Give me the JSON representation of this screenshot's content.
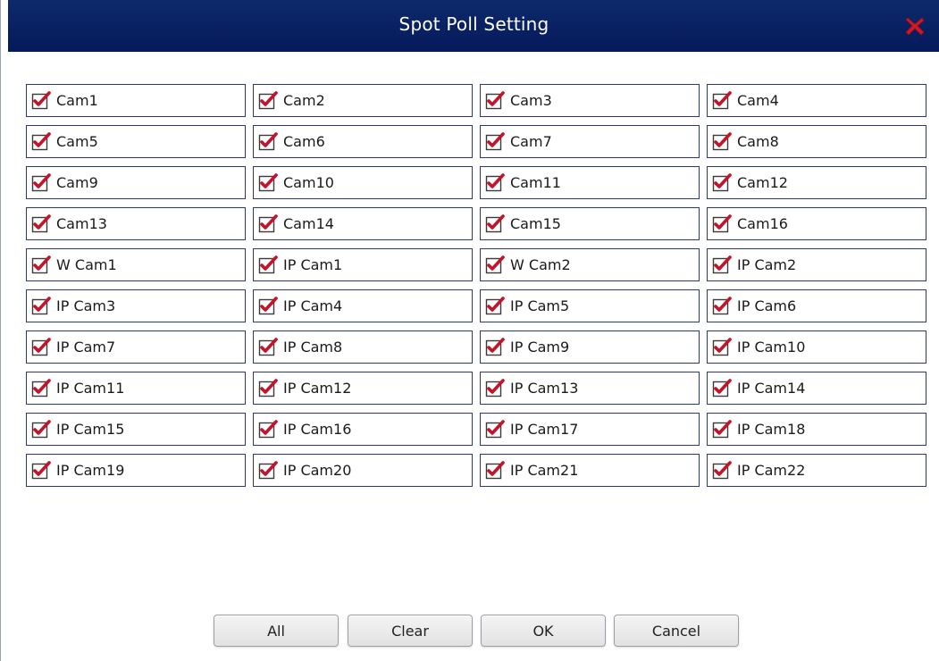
{
  "dialog": {
    "title": "Spot Poll Setting",
    "close_icon": "close-x-icon",
    "accent_color": "#c0152a",
    "titlebar_color": "#0a2466"
  },
  "cameras": [
    {
      "label": "Cam1",
      "checked": true
    },
    {
      "label": "Cam2",
      "checked": true
    },
    {
      "label": "Cam3",
      "checked": true
    },
    {
      "label": "Cam4",
      "checked": true
    },
    {
      "label": "Cam5",
      "checked": true
    },
    {
      "label": "Cam6",
      "checked": true
    },
    {
      "label": "Cam7",
      "checked": true
    },
    {
      "label": "Cam8",
      "checked": true
    },
    {
      "label": "Cam9",
      "checked": true
    },
    {
      "label": "Cam10",
      "checked": true
    },
    {
      "label": "Cam11",
      "checked": true
    },
    {
      "label": "Cam12",
      "checked": true
    },
    {
      "label": "Cam13",
      "checked": true
    },
    {
      "label": "Cam14",
      "checked": true
    },
    {
      "label": "Cam15",
      "checked": true
    },
    {
      "label": "Cam16",
      "checked": true
    },
    {
      "label": "W Cam1",
      "checked": true
    },
    {
      "label": "IP Cam1",
      "checked": true
    },
    {
      "label": "W Cam2",
      "checked": true
    },
    {
      "label": "IP Cam2",
      "checked": true
    },
    {
      "label": "IP Cam3",
      "checked": true
    },
    {
      "label": "IP Cam4",
      "checked": true
    },
    {
      "label": "IP Cam5",
      "checked": true
    },
    {
      "label": "IP Cam6",
      "checked": true
    },
    {
      "label": "IP Cam7",
      "checked": true
    },
    {
      "label": "IP Cam8",
      "checked": true
    },
    {
      "label": "IP Cam9",
      "checked": true
    },
    {
      "label": "IP Cam10",
      "checked": true
    },
    {
      "label": "IP Cam11",
      "checked": true
    },
    {
      "label": "IP Cam12",
      "checked": true
    },
    {
      "label": "IP Cam13",
      "checked": true
    },
    {
      "label": "IP Cam14",
      "checked": true
    },
    {
      "label": "IP Cam15",
      "checked": true
    },
    {
      "label": "IP Cam16",
      "checked": true
    },
    {
      "label": "IP Cam17",
      "checked": true
    },
    {
      "label": "IP Cam18",
      "checked": true
    },
    {
      "label": "IP Cam19",
      "checked": true
    },
    {
      "label": "IP Cam20",
      "checked": true
    },
    {
      "label": "IP Cam21",
      "checked": true
    },
    {
      "label": "IP Cam22",
      "checked": true
    }
  ],
  "buttons": {
    "all": "All",
    "clear": "Clear",
    "ok": "OK",
    "cancel": "Cancel"
  }
}
